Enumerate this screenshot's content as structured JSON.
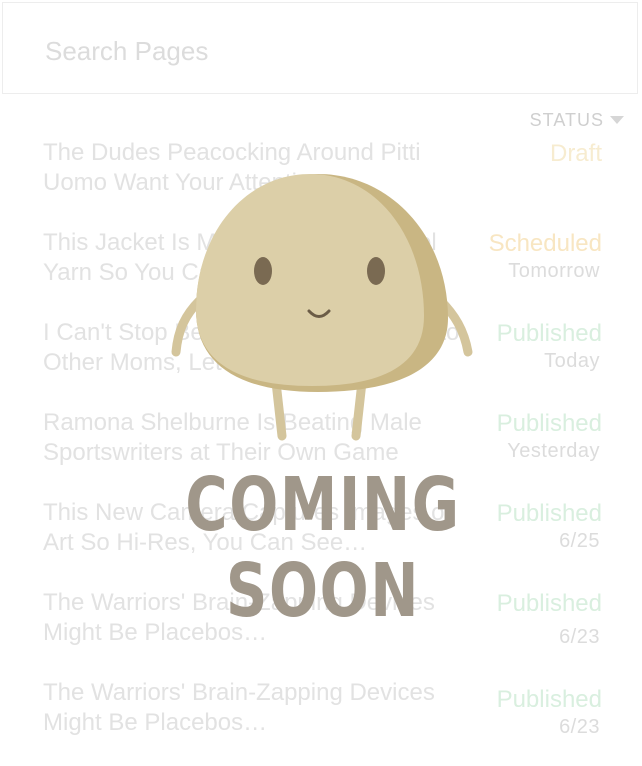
{
  "search": {
    "placeholder": "Search Pages"
  },
  "list_header": {
    "status_label": "STATUS"
  },
  "rows": [
    {
      "title": "The Dudes Peacocking Around Pitti Uomo Want Your Attention",
      "status": "Draft",
      "when": ""
    },
    {
      "title": "This Jacket Is Made of Sheep's Wool Yarn So You Can Stay Warm",
      "status": "Scheduled",
      "when": "Tomorrow"
    },
    {
      "title": "I Can't Stop Being a Mom Who Talks to Other Moms, Let Me Explain",
      "status": "Published",
      "when": "Today"
    },
    {
      "title": "Ramona Shelburne Is Beating Male Sportswriters at Their Own Game",
      "status": "Published",
      "when": "Yesterday"
    },
    {
      "title": "This New Camera Captures Images of Art So Hi-Res, You Can See…",
      "status": "Published",
      "when": "6/25"
    },
    {
      "title": "The Warriors' Brain-Zapping Devices Might Be Placebos…",
      "status": "Published",
      "when": "6/23"
    },
    {
      "title": "The Warriors' Brain-Zapping Devices Might Be Placebos…",
      "status": "Published",
      "when": "6/23"
    }
  ],
  "overlay": {
    "heading": "COMING SOON",
    "mascot": "smiling-blob-mascot"
  },
  "colors": {
    "mascot_body": "#dccfa8",
    "mascot_shade": "#c9b683",
    "heading": "#a0978a",
    "published": "#d9efdf",
    "scheduled": "#f8e6c2",
    "draft": "#f7ecd0"
  }
}
